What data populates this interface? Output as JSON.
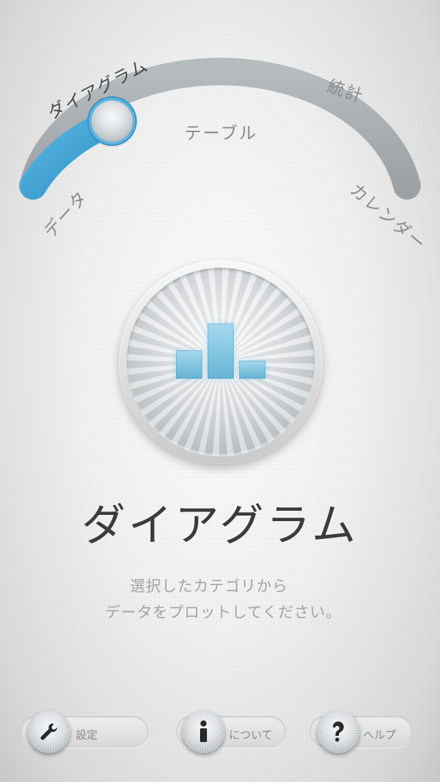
{
  "dial": {
    "labels": {
      "data": "データ",
      "diagram": "ダイアグラム",
      "table": "テーブル",
      "stats": "統計",
      "calendar": "カレンダー"
    },
    "selected": "diagram",
    "track_color": "#a6abae",
    "active_color": "#4aa6d6"
  },
  "main": {
    "title": "ダイアグラム",
    "desc_line1": "選択したカテゴリから",
    "desc_line2": "データをプロットしてください。",
    "icon": "bar-chart-icon"
  },
  "toolbar": {
    "settings_label": "設定",
    "about_label": "について",
    "help_label": "ヘルプ",
    "settings_icon": "wrench-icon",
    "about_icon": "info-icon",
    "help_icon": "question-icon"
  }
}
